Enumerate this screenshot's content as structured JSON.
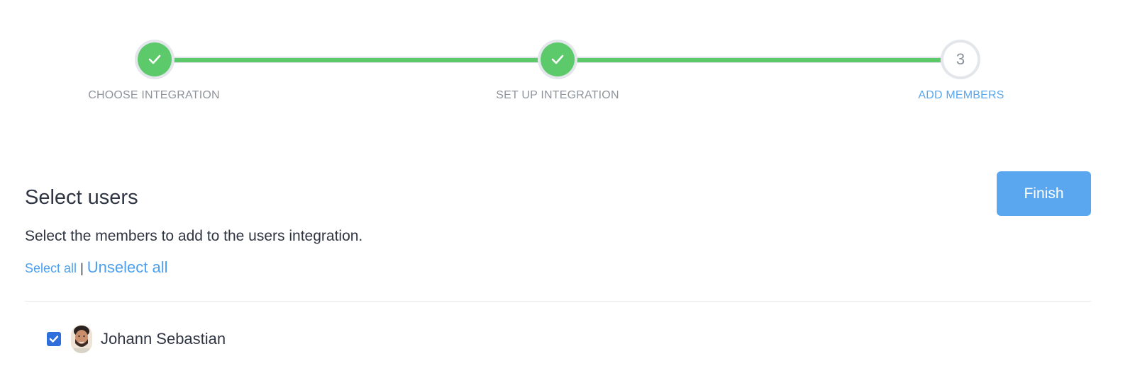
{
  "stepper": {
    "steps": [
      {
        "label": "CHOOSE INTEGRATION",
        "status": "completed"
      },
      {
        "label": "SET UP INTEGRATION",
        "status": "completed"
      },
      {
        "label": "ADD MEMBERS",
        "status": "active",
        "number": "3"
      }
    ],
    "colors": {
      "completed": "#5cc96a",
      "active_label": "#5aa7f0",
      "inactive_label": "#8f959c"
    }
  },
  "content": {
    "title": "Select users",
    "subtitle": "Select the members to add to the users integration.",
    "select_all": "Select all",
    "separator": "|",
    "unselect_all": "Unselect all",
    "finish_label": "Finish"
  },
  "members": [
    {
      "name": "Johann Sebastian",
      "checked": true,
      "avatar": "user-avatar"
    }
  ],
  "icons": {
    "step_done": "checkmark-icon",
    "checkbox": "checkbox-checked-icon"
  },
  "colors": {
    "accent": "#5aa7f0",
    "checkbox": "#2f6fdb",
    "link": "#4c9fee"
  }
}
